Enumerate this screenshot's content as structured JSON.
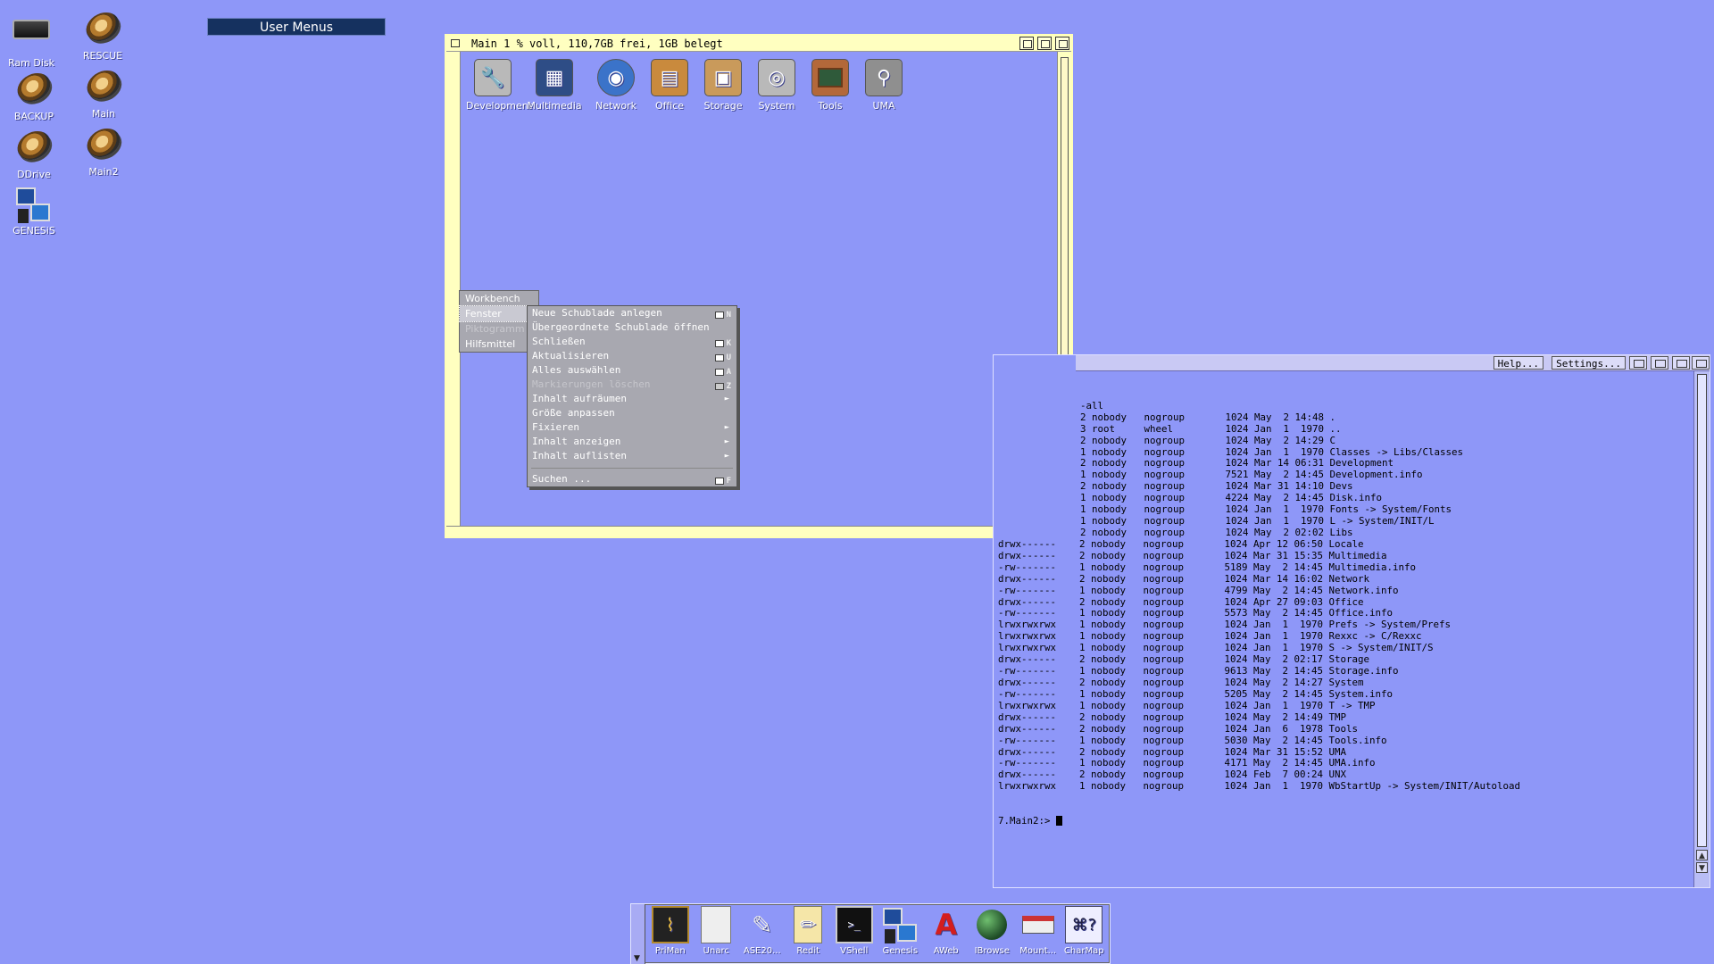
{
  "desktop": {
    "icons": [
      {
        "label": "Ram Disk"
      },
      {
        "label": "RESCUE"
      },
      {
        "label": "BACKUP"
      },
      {
        "label": "Main"
      },
      {
        "label": "DDrive"
      },
      {
        "label": "Main2"
      },
      {
        "label": "GENESiS"
      }
    ],
    "user_menus_title": "User Menus"
  },
  "main_window": {
    "title": "Main  1 % voll, 110,7GB frei, 1GB belegt",
    "drawers": [
      {
        "label": "Development",
        "icon": "wrench-icon",
        "color": "#b9b9b9"
      },
      {
        "label": "Multimedia",
        "icon": "monitor-icon",
        "color": "#2e4d86"
      },
      {
        "label": "Network",
        "icon": "globe-icon",
        "color": "#3b73c9"
      },
      {
        "label": "Office",
        "icon": "calculator-icon",
        "color": "#c98a3d"
      },
      {
        "label": "Storage",
        "icon": "box-icon",
        "color": "#c99a5b"
      },
      {
        "label": "System",
        "icon": "disc-icon",
        "color": "#b9b9b9"
      },
      {
        "label": "Tools",
        "icon": "chalkboard-icon",
        "color": "#b3683a"
      },
      {
        "label": "UMA",
        "icon": "magnifier-icon",
        "color": "#8f8f8f"
      }
    ]
  },
  "menu": {
    "strip": [
      {
        "label": "Workbench",
        "state": "normal"
      },
      {
        "label": "Fenster",
        "state": "selected"
      },
      {
        "label": "Piktogramm",
        "state": "disabled"
      },
      {
        "label": "Hilfsmittel",
        "state": "normal"
      }
    ],
    "submenu": [
      {
        "label": "Neue Schublade anlegen",
        "key": "N",
        "disabled": false,
        "arrow": false
      },
      {
        "label": "Übergeordnete Schublade öffnen",
        "key": "",
        "disabled": false,
        "arrow": false
      },
      {
        "label": "Schließen",
        "key": "K",
        "disabled": false,
        "arrow": false
      },
      {
        "label": "Aktualisieren",
        "key": "U",
        "disabled": false,
        "arrow": false
      },
      {
        "label": "Alles auswählen",
        "key": "A",
        "disabled": false,
        "arrow": false
      },
      {
        "label": "Markierungen löschen",
        "key": "Z",
        "disabled": true,
        "arrow": false
      },
      {
        "label": "Inhalt aufräumen",
        "key": "",
        "disabled": false,
        "arrow": true
      },
      {
        "label": "Größe anpassen",
        "key": "",
        "disabled": false,
        "arrow": false
      },
      {
        "label": "Fixieren",
        "key": "",
        "disabled": false,
        "arrow": true
      },
      {
        "label": "Inhalt anzeigen",
        "key": "",
        "disabled": false,
        "arrow": true
      },
      {
        "label": "Inhalt auflisten",
        "key": "",
        "disabled": false,
        "arrow": true
      },
      {
        "label": "Suchen ...",
        "key": "F",
        "disabled": false,
        "arrow": false
      }
    ]
  },
  "shell_window": {
    "buttons": {
      "help": "Help...",
      "settings": "Settings..."
    },
    "lines": [
      "-all",
      "",
      "2 nobody   nogroup       1024 May  2 14:48 .",
      "3 root     wheel         1024 Jan  1  1970 ..",
      "2 nobody   nogroup       1024 May  2 14:29 C",
      "1 nobody   nogroup       1024 Jan  1  1970 Classes -> Libs/Classes",
      "2 nobody   nogroup       1024 Mar 14 06:31 Development",
      "1 nobody   nogroup       7521 May  2 14:45 Development.info",
      "2 nobody   nogroup       1024 Mar 31 14:10 Devs",
      "1 nobody   nogroup       4224 May  2 14:45 Disk.info",
      "1 nobody   nogroup       1024 Jan  1  1970 Fonts -> System/Fonts",
      "1 nobody   nogroup       1024 Jan  1  1970 L -> System/INIT/L",
      "2 nobody   nogroup       1024 May  2 02:02 Libs",
      "drwx------    2 nobody   nogroup       1024 Apr 12 06:50 Locale",
      "drwx------    2 nobody   nogroup       1024 Mar 31 15:35 Multimedia",
      "-rw-------    1 nobody   nogroup       5189 May  2 14:45 Multimedia.info",
      "drwx------    2 nobody   nogroup       1024 Mar 14 16:02 Network",
      "-rw-------    1 nobody   nogroup       4799 May  2 14:45 Network.info",
      "drwx------    2 nobody   nogroup       1024 Apr 27 09:03 Office",
      "-rw-------    1 nobody   nogroup       5573 May  2 14:45 Office.info",
      "lrwxrwxrwx    1 nobody   nogroup       1024 Jan  1  1970 Prefs -> System/Prefs",
      "lrwxrwxrwx    1 nobody   nogroup       1024 Jan  1  1970 Rexxc -> C/Rexxc",
      "lrwxrwxrwx    1 nobody   nogroup       1024 Jan  1  1970 S -> System/INIT/S",
      "drwx------    2 nobody   nogroup       1024 May  2 02:17 Storage",
      "-rw-------    1 nobody   nogroup       9613 May  2 14:45 Storage.info",
      "drwx------    2 nobody   nogroup       1024 May  2 14:27 System",
      "-rw-------    1 nobody   nogroup       5205 May  2 14:45 System.info",
      "lrwxrwxrwx    1 nobody   nogroup       1024 Jan  1  1970 T -> TMP",
      "drwx------    2 nobody   nogroup       1024 May  2 14:49 TMP",
      "drwx------    2 nobody   nogroup       1024 Jan  6  1978 Tools",
      "-rw-------    1 nobody   nogroup       5030 May  2 14:45 Tools.info",
      "drwx------    2 nobody   nogroup       1024 Mar 31 15:52 UMA",
      "-rw-------    1 nobody   nogroup       4171 May  2 14:45 UMA.info",
      "drwx------    2 nobody   nogroup       1024 Feb  7 00:24 UNX",
      "lrwxrwxrwx    1 nobody   nogroup       1024 Jan  1  1970 WbStartUp -> System/INIT/Autoload"
    ],
    "prompt": "7.Main2:> "
  },
  "dock": {
    "items": [
      {
        "label": "PriMan",
        "icon": "heartbeat-icon"
      },
      {
        "label": "Unarc",
        "icon": "archive-icon"
      },
      {
        "label": "ASE20...",
        "icon": "pen-icon"
      },
      {
        "label": "Redit",
        "icon": "notepad-icon"
      },
      {
        "label": "VShell",
        "icon": "terminal-icon"
      },
      {
        "label": "Genesis",
        "icon": "computer-icon"
      },
      {
        "label": "AWeb",
        "icon": "aweb-icon"
      },
      {
        "label": "IBrowse",
        "icon": "globe-icon"
      },
      {
        "label": "Mount...",
        "icon": "drive-icon"
      },
      {
        "label": "CharMap",
        "icon": "charmap-icon"
      }
    ]
  }
}
